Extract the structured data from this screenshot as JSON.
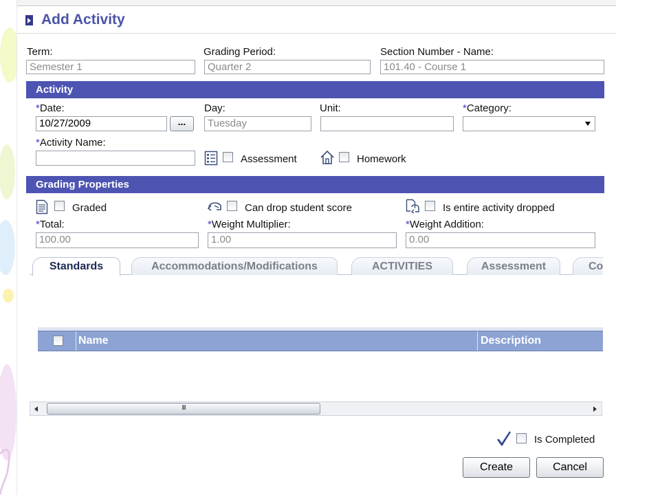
{
  "window": {
    "title": "Add Activity"
  },
  "header_fields": {
    "term": {
      "label": "Term:",
      "value": "Semester 1"
    },
    "grading_period": {
      "label": "Grading Period:",
      "value": "Quarter 2"
    },
    "section": {
      "label": "Section Number - Name:",
      "value": "101.40 - Course 1"
    }
  },
  "activity": {
    "heading": "Activity",
    "required_marker": "*",
    "date": {
      "label": "Date:",
      "value": "10/27/2009",
      "picker_label": "..."
    },
    "day": {
      "label": "Day:",
      "value": "Tuesday"
    },
    "unit": {
      "label": "Unit:",
      "value": ""
    },
    "category": {
      "label": "Category:",
      "value": ""
    },
    "activity_name": {
      "label": "Activity Name:",
      "value": ""
    },
    "assessment": {
      "label": "Assessment",
      "icon": "list-icon",
      "checked": false
    },
    "homework": {
      "label": "Homework",
      "icon": "house-icon",
      "checked": false
    }
  },
  "grading": {
    "heading": "Grading Properties",
    "graded": {
      "label": "Graded",
      "icon": "document-icon",
      "checked": false
    },
    "can_drop": {
      "label": "Can drop student score",
      "icon": "drop-score-icon",
      "checked": false
    },
    "entire_dropped": {
      "label": "Is entire activity dropped",
      "icon": "activity-drop-icon",
      "checked": false
    },
    "total": {
      "label": "Total:",
      "value": "100.00"
    },
    "weight_multiplier": {
      "label": "Weight Multiplier:",
      "value": "1.00"
    },
    "weight_addition": {
      "label": "Weight Addition:",
      "value": "0.00"
    }
  },
  "tabs": [
    {
      "label": "Standards",
      "active": true
    },
    {
      "label": "Accommodations/Modifications",
      "active": false
    },
    {
      "label": "ACTIVITIES",
      "active": false
    },
    {
      "label": "Assessment",
      "active": false
    },
    {
      "label": "Comm",
      "active": false
    }
  ],
  "grid": {
    "columns": [
      "Name",
      "Description"
    ],
    "scroll_grip": "III"
  },
  "footer": {
    "is_completed": {
      "label": "Is Completed",
      "icon": "checkmark-icon",
      "checked": false
    },
    "create_label": "Create",
    "cancel_label": "Cancel"
  },
  "colors": {
    "section_bar": "#4d54b2",
    "title": "#4a54a6",
    "grid_header": "#8ca3d3",
    "required": "#3b3bd0"
  }
}
